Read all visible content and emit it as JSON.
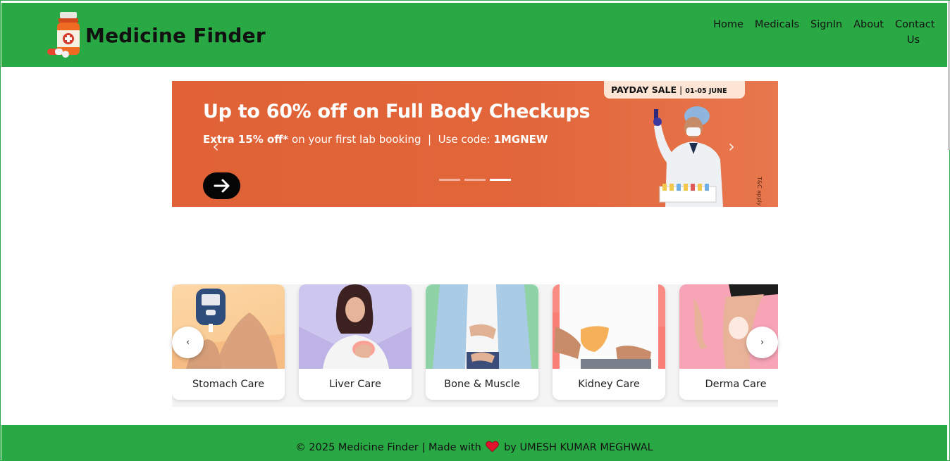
{
  "header": {
    "brand": "Medicine Finder",
    "nav": [
      "Home",
      "Medicals",
      "SignIn",
      "About",
      "Contact Us"
    ]
  },
  "banner": {
    "sale_tag": "PAYDAY SALE",
    "sale_dates": "01-05 JUNE",
    "title": "Up to 60% off on Full Body Checkups",
    "sub_bold": "Extra 15% off*",
    "sub_text": " on your first lab booking  |  Use code: ",
    "code": "1MGNEW",
    "tc": "T&C apply",
    "prev_glyph": "‹",
    "next_glyph": "›"
  },
  "categories": {
    "items": [
      "Stomach Care",
      "Liver Care",
      "Bone & Muscle",
      "Kidney Care",
      "Derma Care"
    ],
    "prev": "‹",
    "next": "›"
  },
  "footer": {
    "before_heart": "© 2025 Medicine Finder | Made with ",
    "after_heart": " by UMESH KUMAR MEGHWAL"
  },
  "colors": {
    "header_green": "#29a944",
    "banner_orange": "#e06236"
  }
}
